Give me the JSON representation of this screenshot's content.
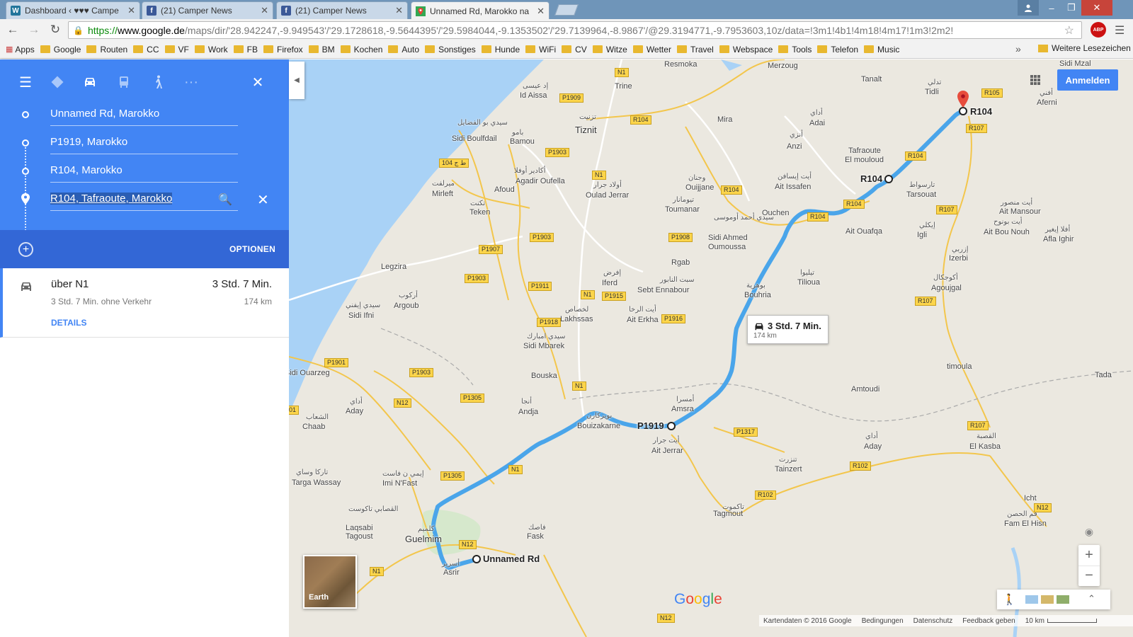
{
  "tabs": [
    {
      "label": "Dashboard ‹ ♥♥♥ Campe",
      "icon": "wordpress-icon"
    },
    {
      "label": "(21) Camper News",
      "icon": "facebook-icon"
    },
    {
      "label": "(21) Camper News",
      "icon": "facebook-icon"
    },
    {
      "label": "Unnamed Rd, Marokko na",
      "icon": "google-maps-icon"
    }
  ],
  "url": {
    "scheme": "https://",
    "host": "www.google.de",
    "path": "/maps/dir/'28.942247,-9.949543'/'29.1728618,-9.5644395'/'29.5984044,-9.1353502'/'29.7139964,-8.9867'/@29.3194771,-9.7953603,10z/data=!3m1!4b1!4m18!4m17!1m3!2m2!"
  },
  "bookmarks": {
    "apps": "Apps",
    "items": [
      "Google",
      "Routen",
      "CC",
      "VF",
      "Work",
      "FB",
      "Firefox",
      "BM",
      "Kochen",
      "Auto",
      "Sonstiges",
      "Hunde",
      "WiFi",
      "CV",
      "Witze",
      "Wetter",
      "Travel",
      "Webspace",
      "Tools",
      "Telefon",
      "Music"
    ],
    "more": "»",
    "other": "Weitere Lesezeichen"
  },
  "directions": {
    "waypoints": [
      "Unnamed Rd, Marokko",
      "P1919, Marokko",
      "R104, Marokko",
      "R104, Tafraoute, Marokko"
    ],
    "options_label": "OPTIONEN",
    "route": {
      "via": "über N1",
      "time": "3 Std. 7 Min.",
      "subtitle": "3 Std. 7 Min. ohne Verkehr",
      "distance": "174 km",
      "details_label": "DETAILS"
    }
  },
  "map": {
    "signin_label": "Anmelden",
    "callout": {
      "time": "3 Std. 7 Min.",
      "distance": "174 km"
    },
    "earth_label": "Earth",
    "google_logo": "Google",
    "waypoint_labels": {
      "start": "Unnamed Rd",
      "wp2": "P1919",
      "wp3": "R104",
      "end": "R104"
    },
    "places": [
      {
        "name": "Resmoka"
      },
      {
        "name": "Merzoug"
      },
      {
        "name": "إد عيسى"
      },
      {
        "name": "Id Aissa"
      },
      {
        "name": "Trine"
      },
      {
        "name": "تزنيت"
      },
      {
        "name": "Tiznit"
      },
      {
        "name": "سيدي بو الفضايل"
      },
      {
        "name": "Sidi Boulfdail"
      },
      {
        "name": "بامو"
      },
      {
        "name": "Bamou"
      },
      {
        "name": "Mira"
      },
      {
        "name": "أداي"
      },
      {
        "name": "Adai"
      },
      {
        "name": "أنزي"
      },
      {
        "name": "Anzi"
      },
      {
        "name": "Tafraoute"
      },
      {
        "name": "El mouloud"
      },
      {
        "name": "Tanalt"
      },
      {
        "name": "تدلي"
      },
      {
        "name": "Tidli"
      },
      {
        "name": "Sidi Mzal"
      },
      {
        "name": "أفني"
      },
      {
        "name": "Aferni"
      },
      {
        "name": "ميرلفت"
      },
      {
        "name": "Mirleft"
      },
      {
        "name": "أكادير أوفلا"
      },
      {
        "name": "Agadir Oufella"
      },
      {
        "name": "Afoud"
      },
      {
        "name": "أولاد جرار"
      },
      {
        "name": "Oulad Jerrar"
      },
      {
        "name": "وجنان"
      },
      {
        "name": "Ouijjane"
      },
      {
        "name": "أيت إيسافن"
      },
      {
        "name": "Ait Issafen"
      },
      {
        "name": "تارسواط"
      },
      {
        "name": "Tarsouat"
      },
      {
        "name": "أيت منصور"
      },
      {
        "name": "Ait Mansour"
      },
      {
        "name": "تكنت"
      },
      {
        "name": "Teken"
      },
      {
        "name": "تيومانار"
      },
      {
        "name": "Toumanar"
      },
      {
        "name": "Ouchen"
      },
      {
        "name": "Ait Ouafqa"
      },
      {
        "name": "إيكلي"
      },
      {
        "name": "Igli"
      },
      {
        "name": "أيت بونوح"
      },
      {
        "name": "Ait Bou Nouh"
      },
      {
        "name": "أفلا إيغير"
      },
      {
        "name": "Afla Ighir"
      },
      {
        "name": "سيدي أحمد أوموسى"
      },
      {
        "name": "Sidi Ahmed"
      },
      {
        "name": "Oumoussa"
      },
      {
        "name": "Rgab"
      },
      {
        "name": "Legzira"
      },
      {
        "name": "إفرض"
      },
      {
        "name": "Iferd"
      },
      {
        "name": "سبت النابور"
      },
      {
        "name": "Sebt Ennabour"
      },
      {
        "name": "تيليوا"
      },
      {
        "name": "Tilioua"
      },
      {
        "name": "بوهرية"
      },
      {
        "name": "Bouhria"
      },
      {
        "name": "إزربي"
      },
      {
        "name": "Izerbi"
      },
      {
        "name": "أكوجكال"
      },
      {
        "name": "Agoujgal"
      },
      {
        "name": "أركوب"
      },
      {
        "name": "Argoub"
      },
      {
        "name": "سيدي إيفني"
      },
      {
        "name": "Sidi Ifni"
      },
      {
        "name": "لخصاص"
      },
      {
        "name": "Lakhssas"
      },
      {
        "name": "أيت الرخا"
      },
      {
        "name": "Ait Erkha"
      },
      {
        "name": "سيدي امبارك"
      },
      {
        "name": "Sidi Mbarek"
      },
      {
        "name": "Sidi Ouarzeg"
      },
      {
        "name": "Bouska"
      },
      {
        "name": "timoula"
      },
      {
        "name": "Amtoudi"
      },
      {
        "name": "Tada"
      },
      {
        "name": "أداي"
      },
      {
        "name": "Aday"
      },
      {
        "name": "الشعاب"
      },
      {
        "name": "Chaab"
      },
      {
        "name": "أنجا"
      },
      {
        "name": "Andja"
      },
      {
        "name": "بويزكارن"
      },
      {
        "name": "Bouizakarne"
      },
      {
        "name": "أمسرا"
      },
      {
        "name": "Amsra"
      },
      {
        "name": "أيت جرار"
      },
      {
        "name": "Ait Jerrar"
      },
      {
        "name": "أداي"
      },
      {
        "name": "Aday"
      },
      {
        "name": "تنزرت"
      },
      {
        "name": "Tainzert"
      },
      {
        "name": "القصبة"
      },
      {
        "name": "El Kasba"
      },
      {
        "name": "تاركا وساي"
      },
      {
        "name": "Targa Wassay"
      },
      {
        "name": "إيمي ن فاست"
      },
      {
        "name": "Imi N'Fast"
      },
      {
        "name": "تاكموت"
      },
      {
        "name": "Tagmout"
      },
      {
        "name": "Icht"
      },
      {
        "name": "فم الحصن"
      },
      {
        "name": "Fam El Hisn"
      },
      {
        "name": "القصابي تاكوست"
      },
      {
        "name": "Laqsabi"
      },
      {
        "name": "Tagoust"
      },
      {
        "name": "كلميم"
      },
      {
        "name": "Guelmim"
      },
      {
        "name": "فاصك"
      },
      {
        "name": "Fask"
      },
      {
        "name": "أسرير"
      },
      {
        "name": "Asrir"
      }
    ],
    "roads": [
      "N1",
      "P1909",
      "R104",
      "P1903",
      "ط ج 104",
      "N1",
      "R104",
      "R104",
      "R104",
      "R107",
      "R104",
      "R105",
      "R107",
      "P1907",
      "P1903",
      "P1903",
      "P1908",
      "P1911",
      "N1",
      "P1915",
      "P1916",
      "P1918",
      "R107",
      "P1901",
      "P1903",
      "N12",
      "P1305",
      "N1",
      "P1317",
      "R107",
      "R102",
      "R102",
      "P1305",
      "N1",
      "N12",
      "N1",
      "N12",
      "N12",
      "01"
    ],
    "footer": {
      "data": "Kartendaten © 2016 Google",
      "terms": "Bedingungen",
      "privacy": "Datenschutz",
      "feedback": "Feedback geben",
      "scale": "10 km"
    }
  },
  "colors": {
    "route": "#4aa5ea",
    "panel": "#4285f4",
    "land": "#ebe8e0",
    "water": "#a9d2f6"
  }
}
